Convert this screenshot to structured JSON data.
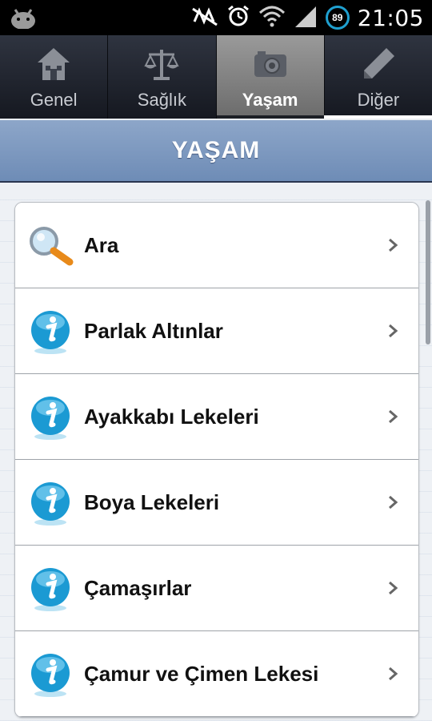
{
  "status_bar": {
    "time": "21:05",
    "battery_level": "89",
    "icons": [
      "android-icon",
      "no-signal-icon",
      "alarm-icon",
      "wifi-icon",
      "signal-icon",
      "battery-icon"
    ]
  },
  "tabs": [
    {
      "label": "Genel",
      "icon": "home-icon",
      "active": false
    },
    {
      "label": "Sağlık",
      "icon": "scales-icon",
      "active": false
    },
    {
      "label": "Yaşam",
      "icon": "camera-icon",
      "active": true
    },
    {
      "label": "Diğer",
      "icon": "pencil-icon",
      "active": false
    }
  ],
  "header": {
    "title": "YAŞAM"
  },
  "list": {
    "items": [
      {
        "label": "Ara",
        "icon": "magnifier-icon"
      },
      {
        "label": "Parlak Altınlar",
        "icon": "info-icon"
      },
      {
        "label": "Ayakkabı Lekeleri",
        "icon": "info-icon"
      },
      {
        "label": "Boya Lekeleri",
        "icon": "info-icon"
      },
      {
        "label": "Çamaşırlar",
        "icon": "info-icon"
      },
      {
        "label": "Çamur ve Çimen Lekesi",
        "icon": "info-icon"
      }
    ]
  },
  "colors": {
    "header_bg": "#7f98bf",
    "accent_blue": "#1b9ad3",
    "tab_active_bg": "#8a8a8a"
  }
}
